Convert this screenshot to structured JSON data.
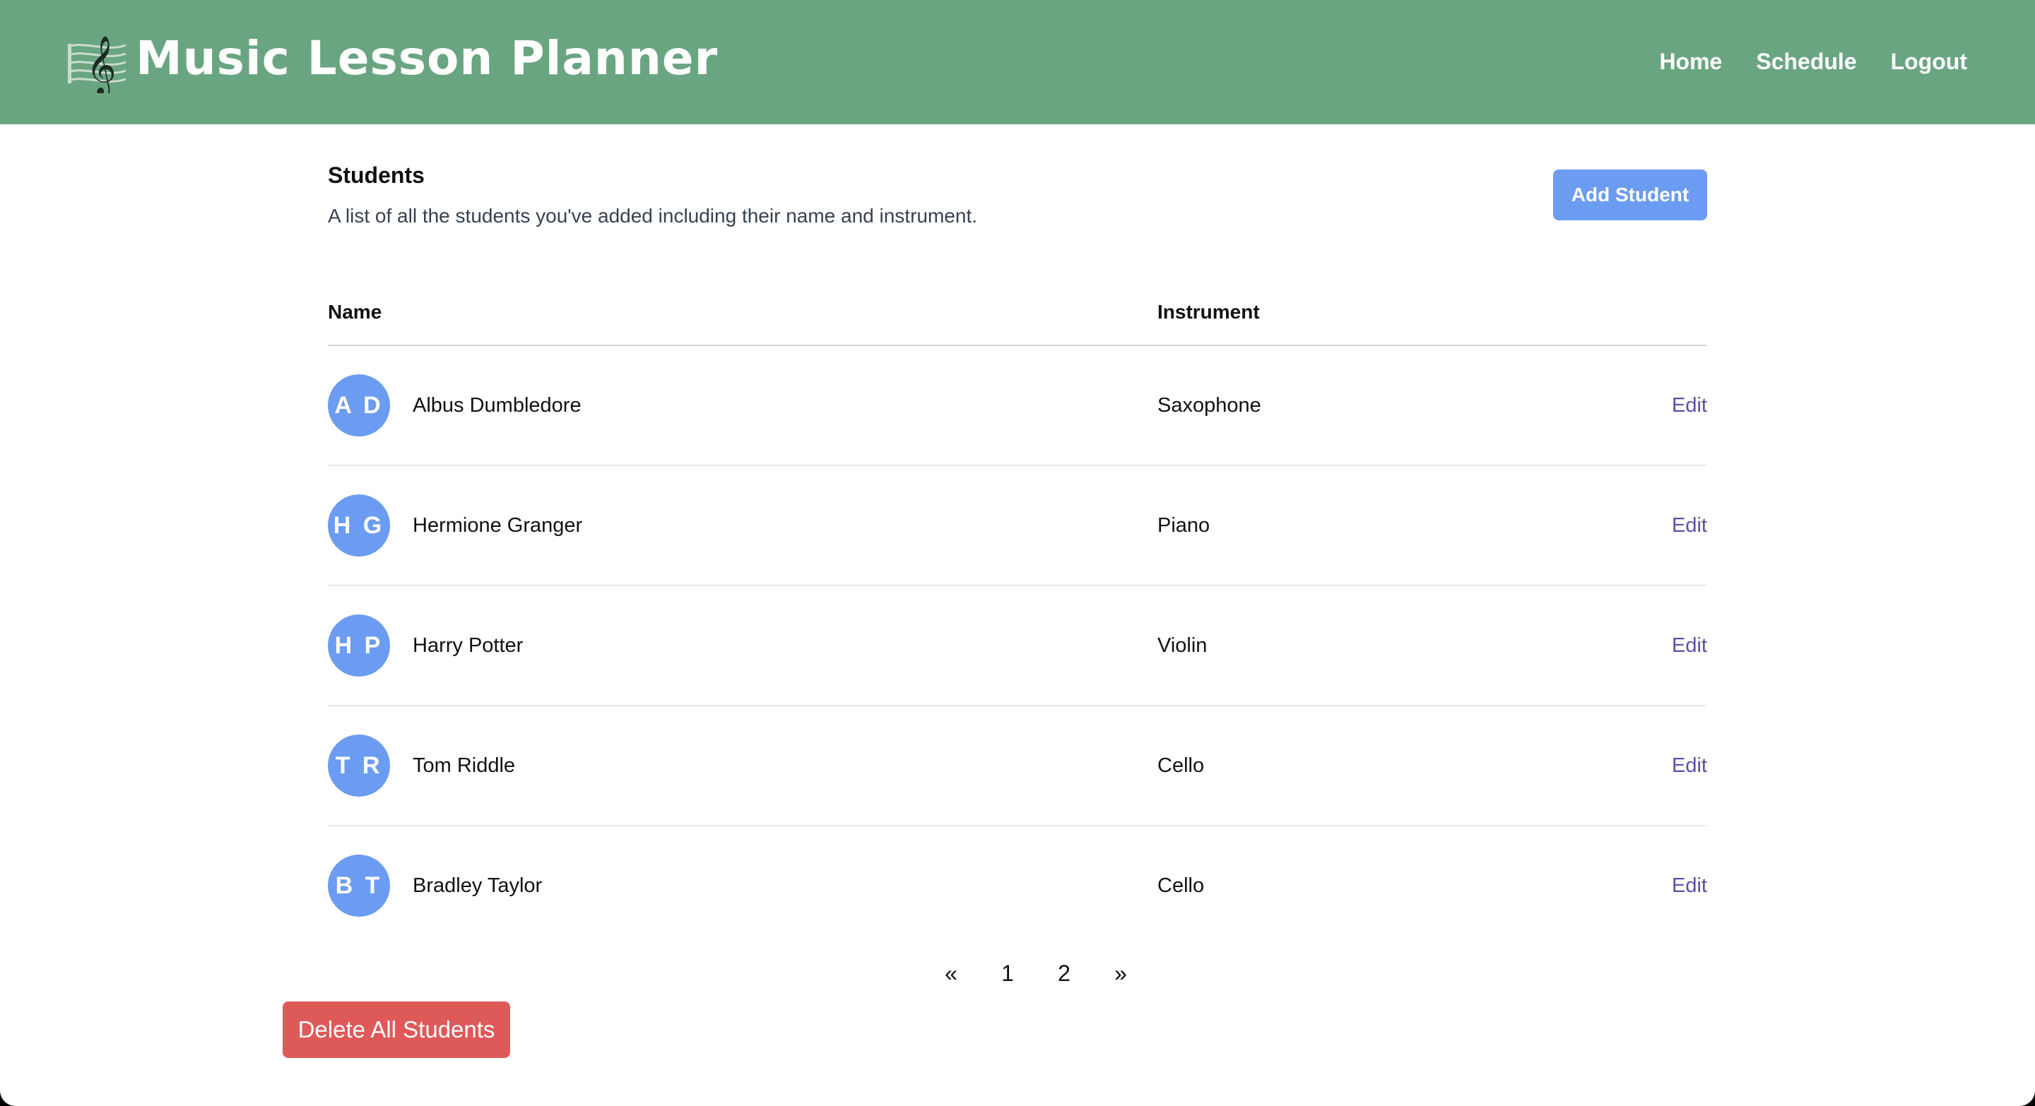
{
  "header": {
    "app_title": "Music Lesson Planner",
    "logo_icon": "treble-clef-icon",
    "nav": [
      "Home",
      "Schedule",
      "Logout"
    ],
    "background": "#6aa582"
  },
  "students_section": {
    "title": "Students",
    "description": "A list of all the students you've added including their name and instrument.",
    "add_button": "Add Student"
  },
  "table": {
    "columns": [
      "Name",
      "Instrument"
    ],
    "rows": [
      {
        "initials": "A D",
        "name": "Albus Dumbledore",
        "instrument": "Saxophone",
        "action": "Edit"
      },
      {
        "initials": "H G",
        "name": "Hermione Granger",
        "instrument": "Piano",
        "action": "Edit"
      },
      {
        "initials": "H P",
        "name": "Harry Potter",
        "instrument": "Violin",
        "action": "Edit"
      },
      {
        "initials": "T R",
        "name": "Tom Riddle",
        "instrument": "Cello",
        "action": "Edit"
      },
      {
        "initials": "B T",
        "name": "Bradley Taylor",
        "instrument": "Cello",
        "action": "Edit"
      }
    ]
  },
  "pagination": {
    "prev": "«",
    "pages": [
      "1",
      "2"
    ],
    "next": "»"
  },
  "delete_button": "Delete All Students",
  "colors": {
    "accent_blue": "#6b9cf1",
    "danger_red": "#de5a59",
    "link_purple": "#5b4fa6"
  }
}
